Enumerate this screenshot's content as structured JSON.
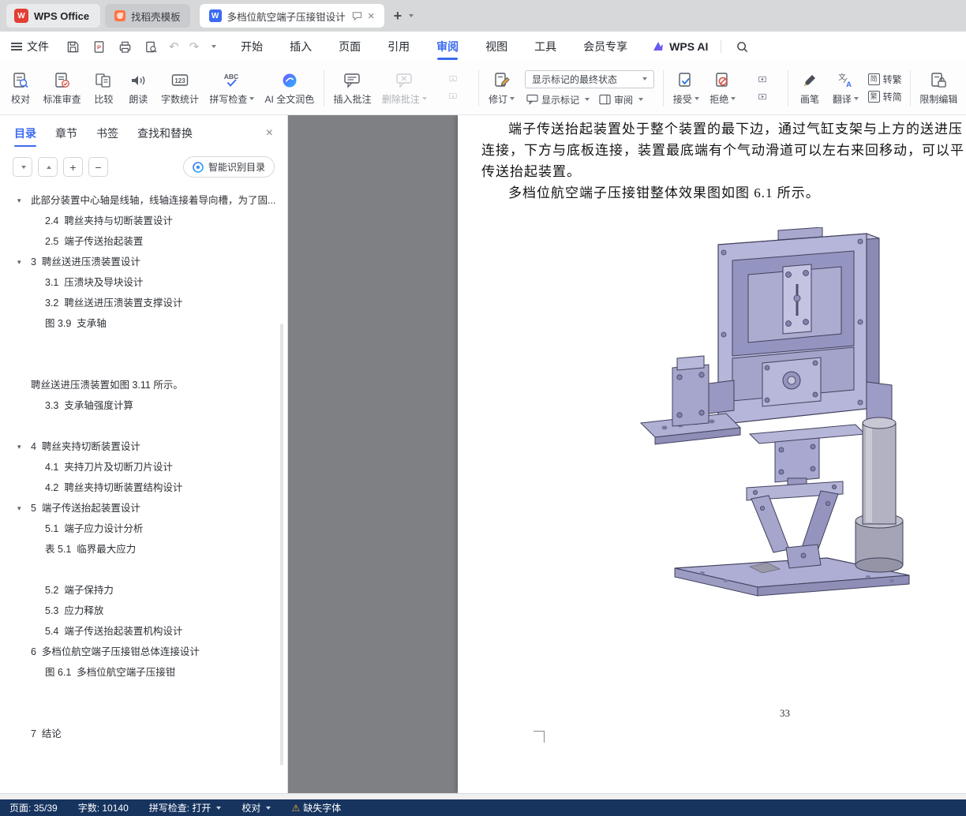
{
  "colors": {
    "accent_blue": "#3b6bf0",
    "wps_red": "#e23e33",
    "docer_orange": "#ff7445",
    "statusbar_bg": "#17345f",
    "canvas_gray": "#7e8084",
    "warning_yellow": "#f6b73c",
    "cad_purple_light": "#b6b6da",
    "cad_purple_mid": "#a4a4ca",
    "cad_purple_dark": "#8a8ab4"
  },
  "icons": {
    "close": "×",
    "plus": "+",
    "minus": "−",
    "undo": "↶",
    "redo": "↷",
    "warning": "⚠",
    "triangle_down": "▾"
  },
  "tabbar": {
    "wps_label": "WPS Office",
    "template_label": "找稻壳模板",
    "doc_title": "多档位航空端子压接钳设计"
  },
  "menubar": {
    "file_label": "文件",
    "items": [
      "开始",
      "插入",
      "页面",
      "引用",
      "审阅",
      "视图",
      "工具",
      "会员专享"
    ],
    "active_item": "审阅",
    "wps_ai_label": "WPS AI"
  },
  "ribbon": {
    "proofread": "校对",
    "standard_review": "标准审查",
    "compare": "比较",
    "read_aloud": "朗读",
    "word_count": "字数统计",
    "spell_check": "拼写检查",
    "ai_polish": "AI 全文润色",
    "insert_comment": "插入批注",
    "delete_comment": "删除批注",
    "revise": "修订",
    "display_state": "显示标记的最终状态",
    "show_marks": "显示标记",
    "review_pane": "审阅",
    "accept": "接受",
    "reject": "拒绝",
    "pen": "画笔",
    "translate": "翻译",
    "s2t_icon": "简",
    "s2t_label": "转繁",
    "t2s_icon": "繁",
    "t2s_label": "转简",
    "restrict_edit": "限制编辑"
  },
  "sidebar": {
    "tabs": [
      "目录",
      "章节",
      "书签",
      "查找和替换"
    ],
    "smart_toc": "智能识别目录",
    "items": [
      "此部分装置中心轴是线轴，线轴连接着导向槽，为了固...",
      "2.4  聘丝夹持与切断装置设计",
      "2.5  端子传送抬起装置",
      "3  聘丝送进压溃装置设计",
      "3.1  压溃块及导块设计",
      "3.2  聘丝送进压溃装置支撑设计",
      "图 3.9  支承轴",
      "聘丝送进压溃装置如图 3.11 所示。",
      "3.3  支承轴强度计算",
      "4  聘丝夹持切断装置设计",
      "4.1  夹持刀片及切断刀片设计",
      "4.2  聘丝夹持切断装置结构设计",
      "5  端子传送抬起装置设计",
      "5.1  端子应力设计分析",
      "表 5.1  临界最大应力",
      "5.2  端子保持力",
      "5.3  应力释放",
      "5.4  端子传送抬起装置机构设计",
      "6  多档位航空端子压接钳总体连接设计",
      "图 6.1  多档位航空端子压接钳",
      "7  结论"
    ]
  },
  "document": {
    "line1": "端子传送抬起装置处于整个装置的最下边，通过气缸支架与上方的送进压",
    "line2": "连接，下方与底板连接，装置最底端有个气动滑道可以左右来回移动，可以平",
    "line3": "传送抬起装置。",
    "line4": "多档位航空端子压接钳整体效果图如图 6.1 所示。",
    "page_number": "33"
  },
  "statusbar": {
    "page_info": "页面: 35/39",
    "word_count": "字数: 10140",
    "spell_check": "拼写检查: 打开",
    "proofread": "校对",
    "missing_font": "缺失字体"
  }
}
